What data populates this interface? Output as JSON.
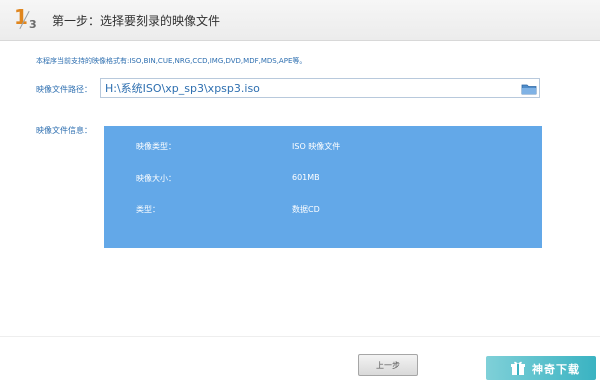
{
  "header": {
    "step_current": "1",
    "step_total": "3",
    "title": "第一步：选择要刻录的映像文件"
  },
  "supported_formats": "本程序当前支持的映像格式有:ISO,BIN,CUE,NRG,CCD,IMG,DVD,MDF,MDS,APE等。",
  "path": {
    "label": "映像文件路径：",
    "value": "H:\\系统ISO\\xp_sp3\\xpsp3.iso",
    "icon": "folder-icon"
  },
  "info": {
    "label": "映像文件信息：",
    "rows": [
      {
        "key": "映像类型：",
        "value": "ISO 映像文件"
      },
      {
        "key": "映像大小：",
        "value": "601MB"
      },
      {
        "key": "类型：",
        "value": "数据CD"
      }
    ]
  },
  "buttons": {
    "prev": "上一步"
  },
  "watermark": {
    "text": "神奇下载"
  },
  "colors": {
    "accent": "#2e6fb0",
    "panel": "#63a8e8",
    "step": "#e0861e",
    "watermark": "#3ab3c2"
  }
}
